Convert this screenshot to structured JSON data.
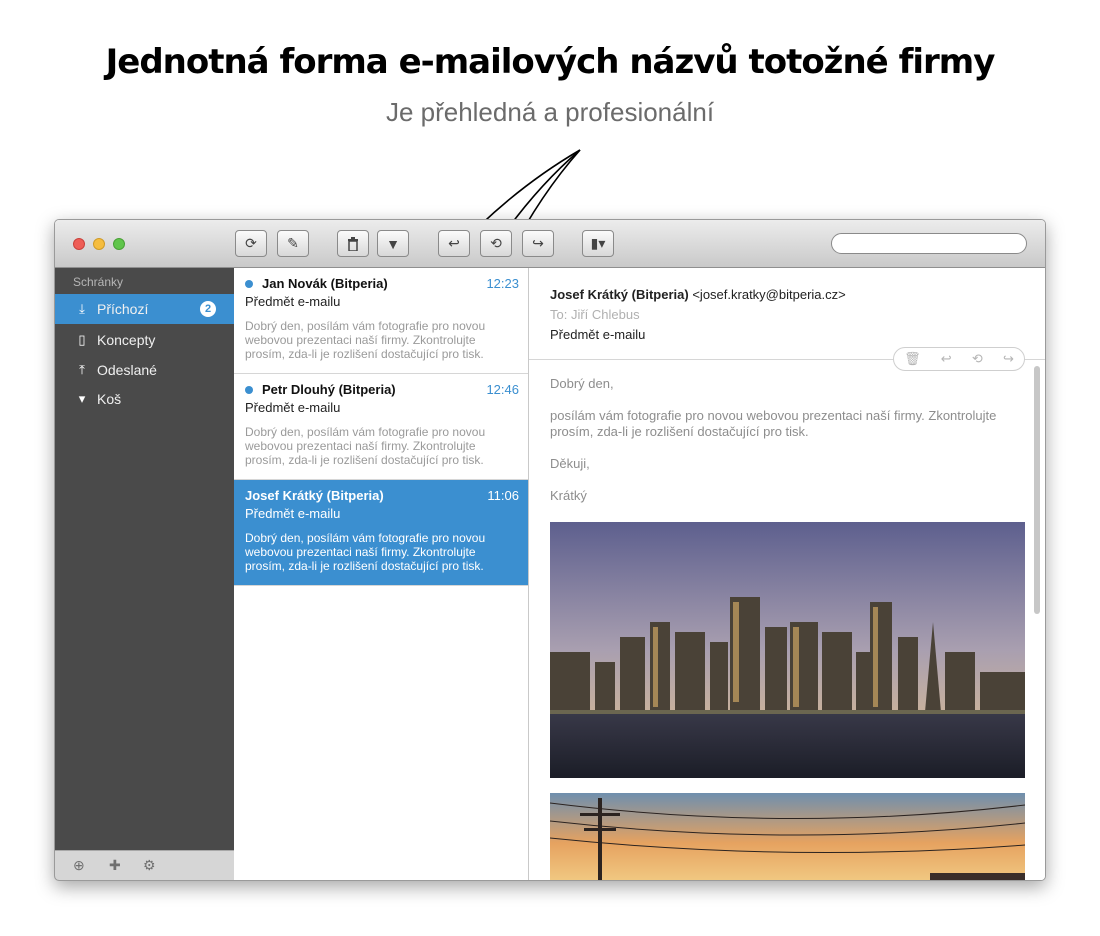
{
  "headline": "Jednotná forma e-mailových názvů totožné firmy",
  "subheadline": "Je přehledná a profesionální",
  "window": {
    "toolbar": {
      "refresh_icon": "refresh-icon",
      "compose_icon": "compose-icon",
      "delete_icon": "trash-icon",
      "junk_icon": "thumbs-down-icon",
      "reply_icon": "reply-icon",
      "reply_all_icon": "reply-all-icon",
      "forward_icon": "forward-icon",
      "flag_icon": "flag-dropdown-icon",
      "search_placeholder": ""
    },
    "sidebar": {
      "heading": "Schránky",
      "items": [
        {
          "label": "Příchozí",
          "icon": "inbox-icon",
          "badge": "2",
          "active": true
        },
        {
          "label": "Koncepty",
          "icon": "document-icon",
          "active": false
        },
        {
          "label": "Odeslané",
          "icon": "sent-icon",
          "active": false
        },
        {
          "label": "Koš",
          "icon": "trash-icon",
          "active": false
        }
      ],
      "footer_icons": [
        "upload-icon",
        "add-icon",
        "gear-icon"
      ]
    },
    "messages": [
      {
        "from": "Jan Novák (Bitperia)",
        "time": "12:23",
        "subject": "Předmět e-mailu",
        "preview": "Dobrý den, posílám vám fotografie pro novou webovou prezentaci naší firmy. Zkontrolujte prosím, zda-li je rozlišení dostačující pro tisk.",
        "unread": true,
        "selected": false
      },
      {
        "from": "Petr Dlouhý (Bitperia)",
        "time": "12:46",
        "subject": "Předmět e-mailu",
        "preview": "Dobrý den, posílám vám fotografie pro novou webovou prezentaci naší firmy. Zkontrolujte prosím, zda-li je rozlišení dostačující pro tisk.",
        "unread": true,
        "selected": false
      },
      {
        "from": "Josef Krátký (Bitperia)",
        "time": "11:06",
        "subject": "Předmět e-mailu",
        "preview": "Dobrý den, posílám vám fotografie pro novou webovou prezentaci naší firmy. Zkontrolujte prosím, zda-li je rozlišení dostačující pro tisk.",
        "unread": false,
        "selected": true
      }
    ],
    "reader": {
      "from_name": "Josef Krátký (Bitperia)",
      "from_email": "<josef.kratky@bitperia.cz>",
      "to": "To: Jiří Chlebus",
      "subject": "Předmět e-mailu",
      "body": {
        "greeting": "Dobrý den,",
        "text": "posílám vám fotografie pro novou webovou prezentaci naší firmy. Zkontrolujte prosím, zda-li je rozlišení dostačující pro tisk.",
        "thanks": "Děkuji,",
        "signature": "Krátký"
      }
    }
  },
  "colors": {
    "accent": "#3b8fd0",
    "sidebar_bg": "#4a4a4a"
  }
}
